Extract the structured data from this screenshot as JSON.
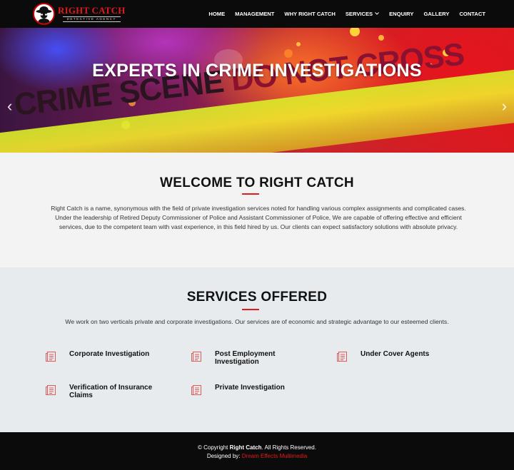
{
  "logo": {
    "name": "RIGHT CATCH",
    "tagline": "DETECTIVE AGENCY"
  },
  "nav": {
    "items": [
      {
        "label": "HOME"
      },
      {
        "label": "MANAGEMENT"
      },
      {
        "label": "WHY RIGHT CATCH"
      },
      {
        "label": "SERVICES",
        "has_dropdown": true
      },
      {
        "label": "ENQUIRY"
      },
      {
        "label": "GALLERY"
      },
      {
        "label": "CONTACT"
      }
    ],
    "dropdown_icon": "chevron-down-icon"
  },
  "hero": {
    "title": "EXPERTS IN CRIME INVESTIGATIONS",
    "tape_text_1": "CRIME SCENE",
    "tape_text_2": "DO NOT CROSS",
    "prev_icon": "chevron-left-icon",
    "next_icon": "chevron-right-icon",
    "prev_glyph": "‹",
    "next_glyph": "›",
    "slides_count": 3,
    "active_slide": 1
  },
  "welcome": {
    "title": "WELCOME TO RIGHT CATCH",
    "body": "Right Catch is a name, synonymous with the field of private investigation services noted for handling various complex assignments and complicated cases. Under the leadership of Retired Deputy Commissioner of Police and Assistant Commissioner of Police, We are capable of offering effective and efficient services, due to the competent team with vast experience, in this field hired by us. Our clients can expect satisfactory solutions with absolute privacy."
  },
  "services": {
    "title": "SERVICES OFFERED",
    "intro": "We work on two verticals private and corporate investigations. Our services are of economic and strategic advantage to our esteemed clients.",
    "icon": "document-list-icon",
    "items": [
      {
        "label": "Corporate Investigation"
      },
      {
        "label": "Post Employment Investigation"
      },
      {
        "label": "Under Cover Agents"
      },
      {
        "label": "Verification of Insurance Claims"
      },
      {
        "label": "Private Investigation"
      }
    ]
  },
  "footer": {
    "copyright_prefix": "© Copyright",
    "brand": "Right Catch",
    "copyright_suffix": ". All Rights Reserved.",
    "designed_by_label": "Designed by:",
    "designer": "Dream Effects Multimedia"
  },
  "colors": {
    "accent": "#e01b1b",
    "nav_bg": "#0b0b0b",
    "welcome_bg": "#f3f3f3",
    "services_bg": "#e8ebee"
  }
}
